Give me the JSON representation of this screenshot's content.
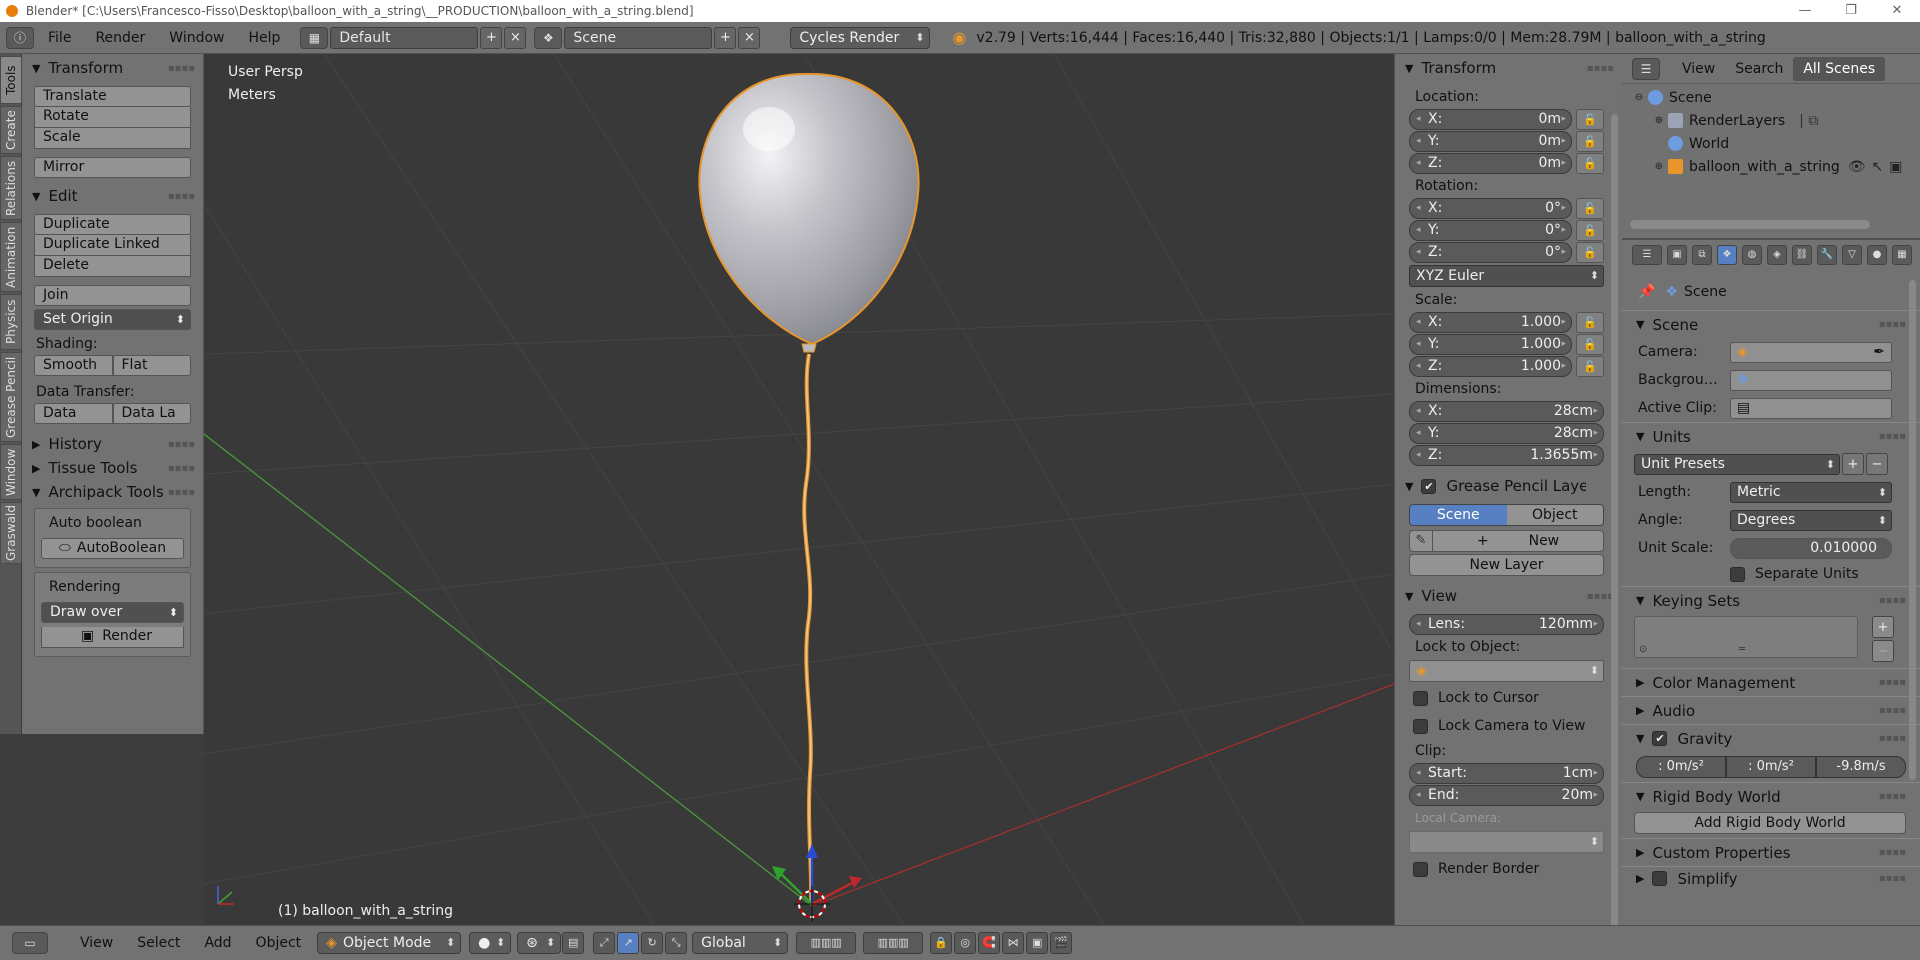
{
  "window": {
    "title": "Blender* [C:\\Users\\Francesco-Fisso\\Desktop\\balloon_with_a_string\\__PRODUCTION\\balloon_with_a_string.blend]",
    "controls": [
      "—",
      "❐",
      "✕"
    ]
  },
  "topbar": {
    "menus": [
      "File",
      "Render",
      "Window",
      "Help"
    ],
    "layout": "Default",
    "scene": "Scene",
    "engine": "Cycles Render",
    "stats": "v2.79 | Verts:16,444 | Faces:16,440 | Tris:32,880 | Objects:1/1 | Lamps:0/0 | Mem:28.79M | balloon_with_a_string"
  },
  "left_tabs": [
    "Tools",
    "Create",
    "Relations",
    "Animation",
    "Physics",
    "Grease Pencil",
    "Window",
    "Graswald"
  ],
  "tools": {
    "transform_title": "Transform",
    "translate": "Translate",
    "rotate": "Rotate",
    "scale": "Scale",
    "mirror": "Mirror",
    "edit_title": "Edit",
    "duplicate": "Duplicate",
    "duplicate_linked": "Duplicate Linked",
    "delete": "Delete",
    "join": "Join",
    "set_origin": "Set Origin",
    "shading_label": "Shading:",
    "smooth": "Smooth",
    "flat": "Flat",
    "data_transfer_label": "Data Transfer:",
    "data": "Data",
    "data_la": "Data La",
    "history_title": "History",
    "tissue_title": "Tissue Tools",
    "archipack_title": "Archipack Tools",
    "auto_boolean_label": "Auto boolean",
    "auto_boolean_btn": "AutoBoolean",
    "rendering_label": "Rendering",
    "draw_over": "Draw over",
    "render_btn": "Render"
  },
  "viewport": {
    "view_name": "User Persp",
    "units": "Meters",
    "object_label": "(1) balloon_with_a_string",
    "colors": {
      "balloon": "#bfbfc4",
      "outline": "#e8962b",
      "x_axis": "#a03030",
      "y_axis": "#4a9a3a"
    }
  },
  "npanel": {
    "transform_title": "Transform",
    "location_label": "Location:",
    "location": [
      {
        "axis": "X:",
        "value": "0m"
      },
      {
        "axis": "Y:",
        "value": "0m"
      },
      {
        "axis": "Z:",
        "value": "0m"
      }
    ],
    "rotation_label": "Rotation:",
    "rotation": [
      {
        "axis": "X:",
        "value": "0°"
      },
      {
        "axis": "Y:",
        "value": "0°"
      },
      {
        "axis": "Z:",
        "value": "0°"
      }
    ],
    "rotation_mode": "XYZ Euler",
    "scale_label": "Scale:",
    "scale": [
      {
        "axis": "X:",
        "value": "1.000"
      },
      {
        "axis": "Y:",
        "value": "1.000"
      },
      {
        "axis": "Z:",
        "value": "1.000"
      }
    ],
    "dimensions_label": "Dimensions:",
    "dimensions": [
      {
        "axis": "X:",
        "value": "28cm"
      },
      {
        "axis": "Y:",
        "value": "28cm"
      },
      {
        "axis": "Z:",
        "value": "1.3655m"
      }
    ],
    "grease_title": "Grease Pencil Layer",
    "gp_scene": "Scene",
    "gp_object": "Object",
    "gp_new": "New",
    "gp_new_layer": "New Layer",
    "view_title": "View",
    "lens_label": "Lens:",
    "lens_value": "120mm",
    "lock_object_label": "Lock to Object:",
    "lock_cursor": "Lock to Cursor",
    "lock_camera": "Lock Camera to View",
    "clip_label": "Clip:",
    "clip_start_label": "Start:",
    "clip_start": "1cm",
    "clip_end_label": "End:",
    "clip_end": "20m",
    "local_camera_label": "Local Camera:",
    "render_border": "Render Border"
  },
  "outliner": {
    "tabs": [
      "View",
      "Search",
      "All Scenes"
    ],
    "items": [
      {
        "name": "Scene",
        "color": "#6f9be0"
      },
      {
        "name": "RenderLayers",
        "color": "#9aa4b4"
      },
      {
        "name": "World",
        "color": "#6f9be0"
      },
      {
        "name": "balloon_with_a_string",
        "color": "#e8962b"
      }
    ]
  },
  "properties": {
    "breadcrumb": "Scene",
    "scene_title": "Scene",
    "camera_label": "Camera:",
    "background_label": "Backgrou…",
    "active_clip_label": "Active Clip:",
    "units_title": "Units",
    "unit_presets": "Unit Presets",
    "length_label": "Length:",
    "length_value": "Metric",
    "angle_label": "Angle:",
    "angle_value": "Degrees",
    "unit_scale_label": "Unit Scale:",
    "unit_scale_value": "0.010000",
    "separate_units": "Separate Units",
    "keying_title": "Keying Sets",
    "color_mgmt_title": "Color Management",
    "audio_title": "Audio",
    "gravity_title": "Gravity",
    "gravity": [
      ": 0m/s²",
      ": 0m/s²",
      "-9.8m/s"
    ],
    "rigid_title": "Rigid Body World",
    "add_rigid": "Add Rigid Body World",
    "custom_props_title": "Custom Properties",
    "simplify_title": "Simplify"
  },
  "bottombar": {
    "menus": [
      "View",
      "Select",
      "Add",
      "Object"
    ],
    "mode": "Object Mode",
    "orientation": "Global"
  }
}
